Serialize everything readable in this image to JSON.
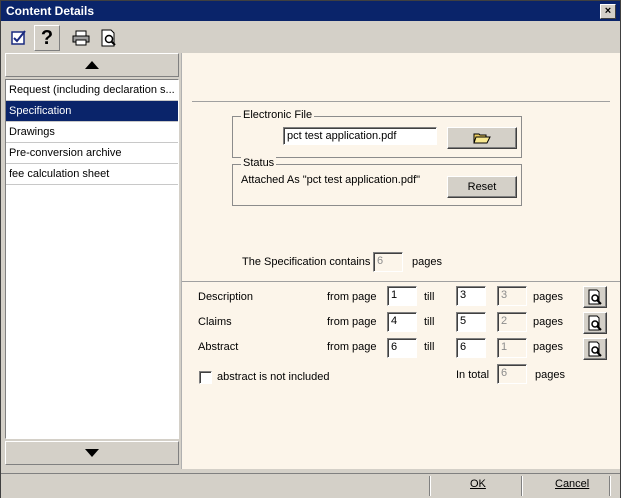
{
  "window": {
    "title": "Content Details",
    "close_glyph": "×"
  },
  "toolbar": {
    "icons": [
      "checkbox-pen-icon",
      "help-icon",
      "print-icon",
      "print-preview-icon"
    ],
    "help_glyph": "?"
  },
  "sidebar": {
    "items": [
      {
        "label": "Request (including declaration s..."
      },
      {
        "label": "Specification",
        "selected": true
      },
      {
        "label": "Drawings"
      },
      {
        "label": "Pre-conversion archive"
      },
      {
        "label": "fee calculation sheet"
      }
    ]
  },
  "electronic_file": {
    "title": "Electronic File",
    "filename": "pct test application.pdf"
  },
  "status": {
    "title": "Status",
    "text": "Attached As \"pct test application.pdf\"",
    "reset_label": "Reset"
  },
  "spec": {
    "contains_label": "The Specification contains",
    "total_pages": "6",
    "pages_label": "pages"
  },
  "sections": {
    "from_label": "from page",
    "till_label": "till",
    "pages_label": "pages",
    "rows": [
      {
        "name": "Description",
        "from": "1",
        "till": "3",
        "count": "3"
      },
      {
        "name": "Claims",
        "from": "4",
        "till": "5",
        "count": "2"
      },
      {
        "name": "Abstract",
        "from": "6",
        "till": "6",
        "count": "1"
      }
    ]
  },
  "abstract_option": {
    "label": "abstract is not included",
    "checked": false
  },
  "total": {
    "label": "In total",
    "value": "6",
    "pages_label": "pages"
  },
  "footer": {
    "ok_label": "OK",
    "cancel_label": "Cancel"
  }
}
